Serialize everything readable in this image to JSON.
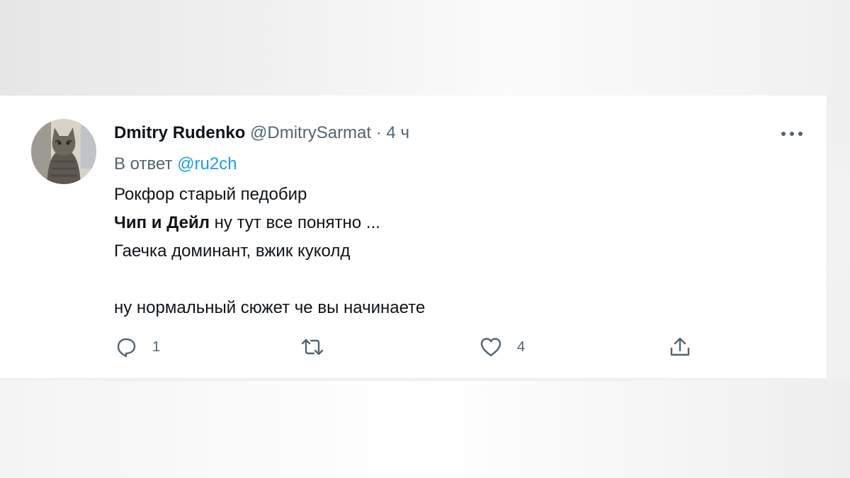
{
  "tweet": {
    "author_name": "Dmitry Rudenko",
    "author_handle": "@DmitrySarmat",
    "separator": "·",
    "time": "4 ч",
    "reply_prefix": "В ответ",
    "reply_to": "@ru2ch",
    "lines": {
      "line1": "Рокфор старый педобир",
      "line2_bold": "Чип и Дейл",
      "line2_rest": " ну тут все понятно ...",
      "line3": "Гаечка доминант, вжик куколд",
      "line5": "ну нормальный сюжет че вы начинаете"
    },
    "actions": {
      "reply_count": "1",
      "retweet_count": "",
      "like_count": "4"
    }
  },
  "icons": {
    "avatar": "cat-photo",
    "more": "more-horizontal-icon",
    "reply": "reply-bubble-icon",
    "retweet": "retweet-icon",
    "like": "heart-icon",
    "share": "share-icon"
  },
  "colors": {
    "text_primary": "#0f1419",
    "text_secondary": "#536471",
    "link": "#1d9bf0"
  }
}
